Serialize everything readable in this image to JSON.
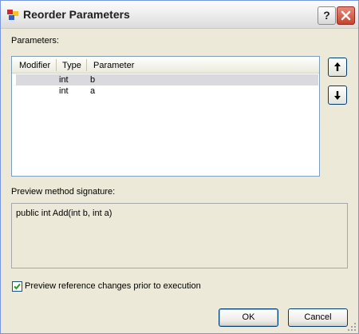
{
  "window": {
    "title": "Reorder Parameters"
  },
  "titlebar": {
    "help_label": "?"
  },
  "parameters": {
    "label": "Parameters:",
    "columns": [
      "Modifier",
      "Type",
      "Parameter"
    ],
    "rows": [
      {
        "modifier": "",
        "type": "int",
        "parameter": "b",
        "selected": true
      },
      {
        "modifier": "",
        "type": "int",
        "parameter": "a",
        "selected": false
      }
    ]
  },
  "preview": {
    "label": "Preview method signature:",
    "signature": "public int Add(int b, int a)"
  },
  "option": {
    "label": "Preview reference changes prior to execution",
    "checked": true
  },
  "buttons": {
    "ok": "OK",
    "cancel": "Cancel"
  }
}
